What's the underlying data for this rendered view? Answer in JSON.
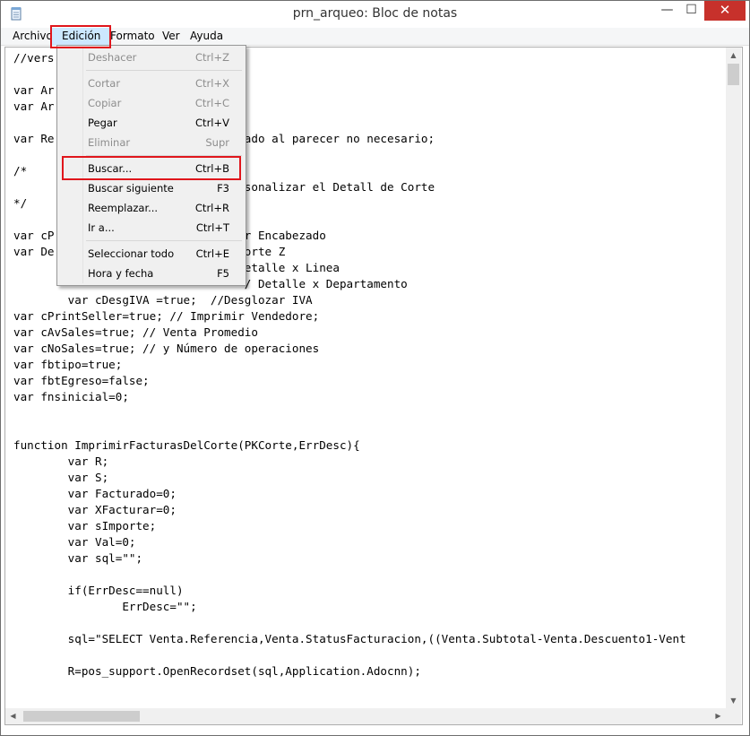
{
  "window": {
    "title": "prn_arqueo: Bloc de notas",
    "minimize": "—",
    "maximize": "☐",
    "close": "✕"
  },
  "menubar": {
    "items": [
      "Archivo",
      "Edición",
      "Formato",
      "Ver",
      "Ayuda"
    ],
    "active": "Edición"
  },
  "edit_menu": {
    "items": [
      {
        "label": "Deshacer",
        "shortcut": "Ctrl+Z",
        "enabled": false
      },
      {
        "label": "Cortar",
        "shortcut": "Ctrl+X",
        "enabled": false
      },
      {
        "label": "Copiar",
        "shortcut": "Ctrl+C",
        "enabled": false
      },
      {
        "label": "Pegar",
        "shortcut": "Ctrl+V",
        "enabled": true
      },
      {
        "label": "Eliminar",
        "shortcut": "Supr",
        "enabled": false
      },
      {
        "label": "Buscar...",
        "shortcut": "Ctrl+B",
        "enabled": true,
        "highlighted": true
      },
      {
        "label": "Buscar siguiente",
        "shortcut": "F3",
        "enabled": true
      },
      {
        "label": "Reemplazar...",
        "shortcut": "Ctrl+R",
        "enabled": true
      },
      {
        "label": "Ir a...",
        "shortcut": "Ctrl+T",
        "enabled": true
      },
      {
        "label": "Seleccionar todo",
        "shortcut": "Ctrl+E",
        "enabled": true
      },
      {
        "label": "Hora y fecha",
        "shortcut": "F5",
        "enabled": true
      }
    ]
  },
  "editor": {
    "lines": [
      "//vers",
      "",
      "var Ar",
      "var Ar",
      "",
      "var Re                            ado al parecer no necesario;",
      "",
      "/*",
      "                                  sonalizar el Detall de Corte",
      "*/",
      "",
      "var cP                            r Encabezado",
      "var De                            orte Z",
      "                                  etalle x Linea",
      "                                  / Detalle x Departamento",
      "        var cDesgIVA =true;  //Desglozar IVA",
      "var cPrintSeller=true; // Imprimir Vendedore;",
      "var cAvSales=true; // Venta Promedio",
      "var cNoSales=true; // y Número de operaciones",
      "var fbtipo=true;",
      "var fbtEgreso=false;",
      "var fnsinicial=0;",
      "",
      "",
      "function ImprimirFacturasDelCorte(PKCorte,ErrDesc){",
      "        var R;",
      "        var S;",
      "        var Facturado=0;",
      "        var XFacturar=0;",
      "        var sImporte;",
      "        var Val=0;",
      "        var sql=\"\";",
      "",
      "        if(ErrDesc==null)",
      "                ErrDesc=\"\";",
      "",
      "        sql=\"SELECT Venta.Referencia,Venta.StatusFacturacion,((Venta.Subtotal-Venta.Descuento1-Vent",
      "",
      "        R=pos_support.OpenRecordset(sql,Application.Adocnn);"
    ]
  },
  "scrollbars": {
    "up_arrow": "▲",
    "down_arrow": "▼",
    "left_arrow": "◀",
    "right_arrow": "▶"
  }
}
